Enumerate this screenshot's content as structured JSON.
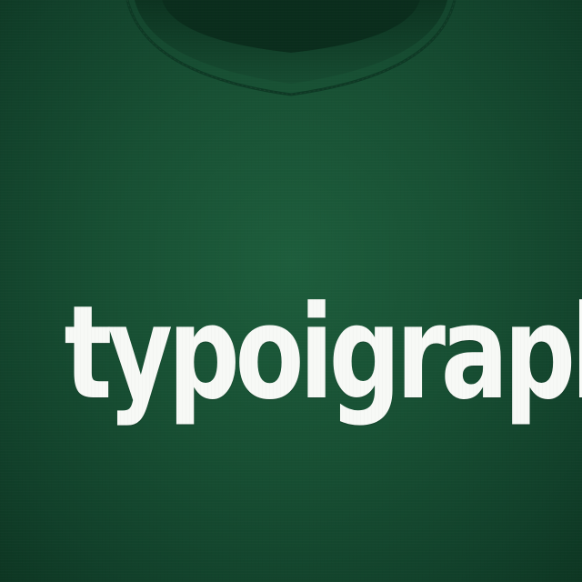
{
  "shirt": {
    "fabric_color": "#174f33",
    "collar_color": "#0f3d27",
    "ink_color": "#f7f9f6"
  },
  "print": {
    "text": "typoigraphy"
  }
}
